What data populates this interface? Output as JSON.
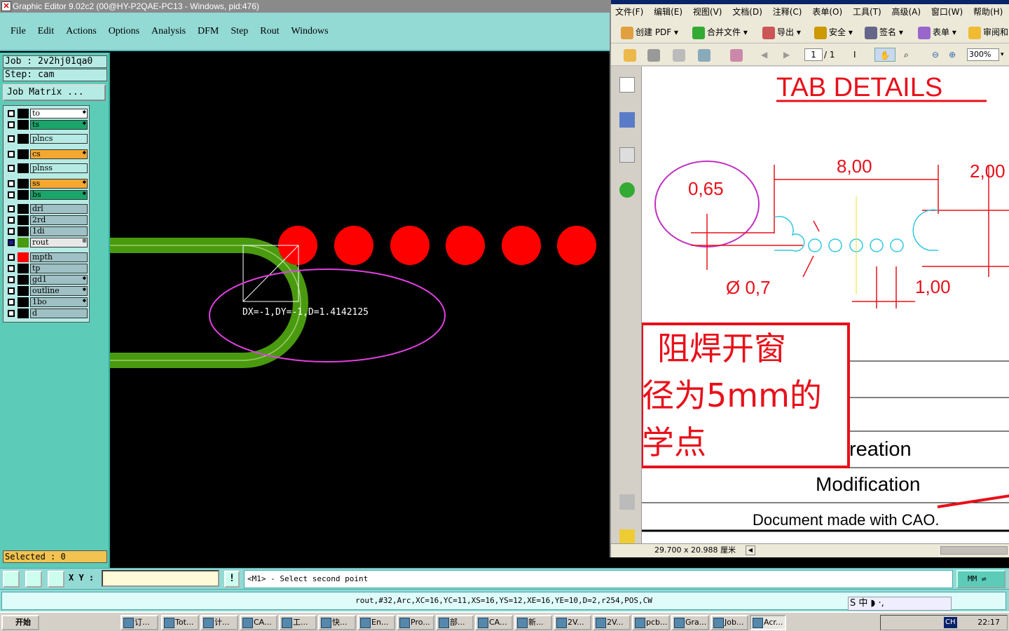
{
  "graphic_editor": {
    "title": "Graphic Editor 9.02c2 (00@HY-P2QAE-PC13 - Windows, pid:476)",
    "menu": [
      "File",
      "Edit",
      "Actions",
      "Options",
      "Analysis",
      "DFM",
      "Step",
      "Rout",
      "Windows"
    ],
    "job_label": "Job : 2v2hj01qa0",
    "step_label": "Step: cam",
    "job_matrix_button": "Job Matrix ...",
    "layers": [
      {
        "name": "to",
        "color": "#ffffff",
        "marker": "◆"
      },
      {
        "name": "ts",
        "color": "#1aa56a",
        "marker": "◆"
      },
      {
        "name": "plncs",
        "color": "#b6ebe5",
        "marker": ""
      },
      {
        "name": "cs",
        "color": "#f4a830",
        "marker": "◆"
      },
      {
        "name": "plnss",
        "color": "#b6ebe5",
        "marker": ""
      },
      {
        "name": "ss",
        "color": "#f4a830",
        "marker": "◆"
      },
      {
        "name": "bs",
        "color": "#1aa56a",
        "marker": "◆"
      },
      {
        "name": "drl",
        "color": "#9fc0c4",
        "marker": ""
      },
      {
        "name": "2rd",
        "color": "#9fc0c4",
        "marker": ""
      },
      {
        "name": "1di",
        "color": "#9fc0c4",
        "marker": ""
      },
      {
        "name": "rout",
        "color": "#e8e8e8",
        "marker": "⊞"
      },
      {
        "name": "mpth",
        "color": "#9fc0c4",
        "marker": ""
      },
      {
        "name": "tp",
        "color": "#9fc0c4",
        "marker": ""
      },
      {
        "name": "gd1",
        "color": "#9fc0c4",
        "marker": "◆"
      },
      {
        "name": "outline",
        "color": "#9fc0c4",
        "marker": "◆"
      },
      {
        "name": "1bo",
        "color": "#9fc0c4",
        "marker": "◆"
      },
      {
        "name": "d",
        "color": "#9fc0c4",
        "marker": ""
      }
    ],
    "selected_label": "Selected : 0",
    "measure_text": "DX=-1,DY=-1,D=1.4142125",
    "xy_label": "X Y :",
    "xy_value": "",
    "prompt": "<M1> - Select second point",
    "units": "MM",
    "info": "rout,#32,Arc,XC=16,YC=11,XS=16,YS=12,XE=16,YE=10,D=2,r254,POS,CW",
    "colors": {
      "pad": "#ff0000",
      "route": "#4a9a10",
      "ellipse": "#e040e0"
    }
  },
  "acrobat": {
    "menu": [
      "文件(F)",
      "编辑(E)",
      "视图(V)",
      "文档(D)",
      "注释(C)",
      "表单(O)",
      "工具(T)",
      "高级(A)",
      "窗口(W)",
      "帮助(H)"
    ],
    "toolbar1": [
      "创建 PDF",
      "合并文件",
      "导出",
      "安全",
      "签名",
      "表单",
      "审阅和"
    ],
    "page_current": "1",
    "page_total": "/ 1",
    "zoom": "300%",
    "page_size": "29.700 x 20.988 厘米",
    "pdf": {
      "heading": "TAB DETAILS",
      "dim_065": "0,65",
      "dim_800": "8,00",
      "dim_200": "2,00",
      "dim_07": "Ø 0,7",
      "dim_100": "1,00",
      "cn_line1": "阻焊开窗",
      "cn_line2": "径为5mm的",
      "cn_line3": "学点",
      "row_creation": "reation",
      "row_modification": "Modification",
      "row_document": "Document made with CAO."
    }
  },
  "taskbar": {
    "start": "开始",
    "tasks": [
      "订...",
      "Tot...",
      "计...",
      "CA...",
      "工...",
      "快...",
      "En...",
      "Pro...",
      "部...",
      "CA...",
      "新...",
      "2V...",
      "2V...",
      "pcb...",
      "Gra...",
      "Job...",
      "Acr..."
    ],
    "ime": "S 中 ◗ ·,",
    "tray_lang": "CH",
    "clock": "22:17"
  }
}
